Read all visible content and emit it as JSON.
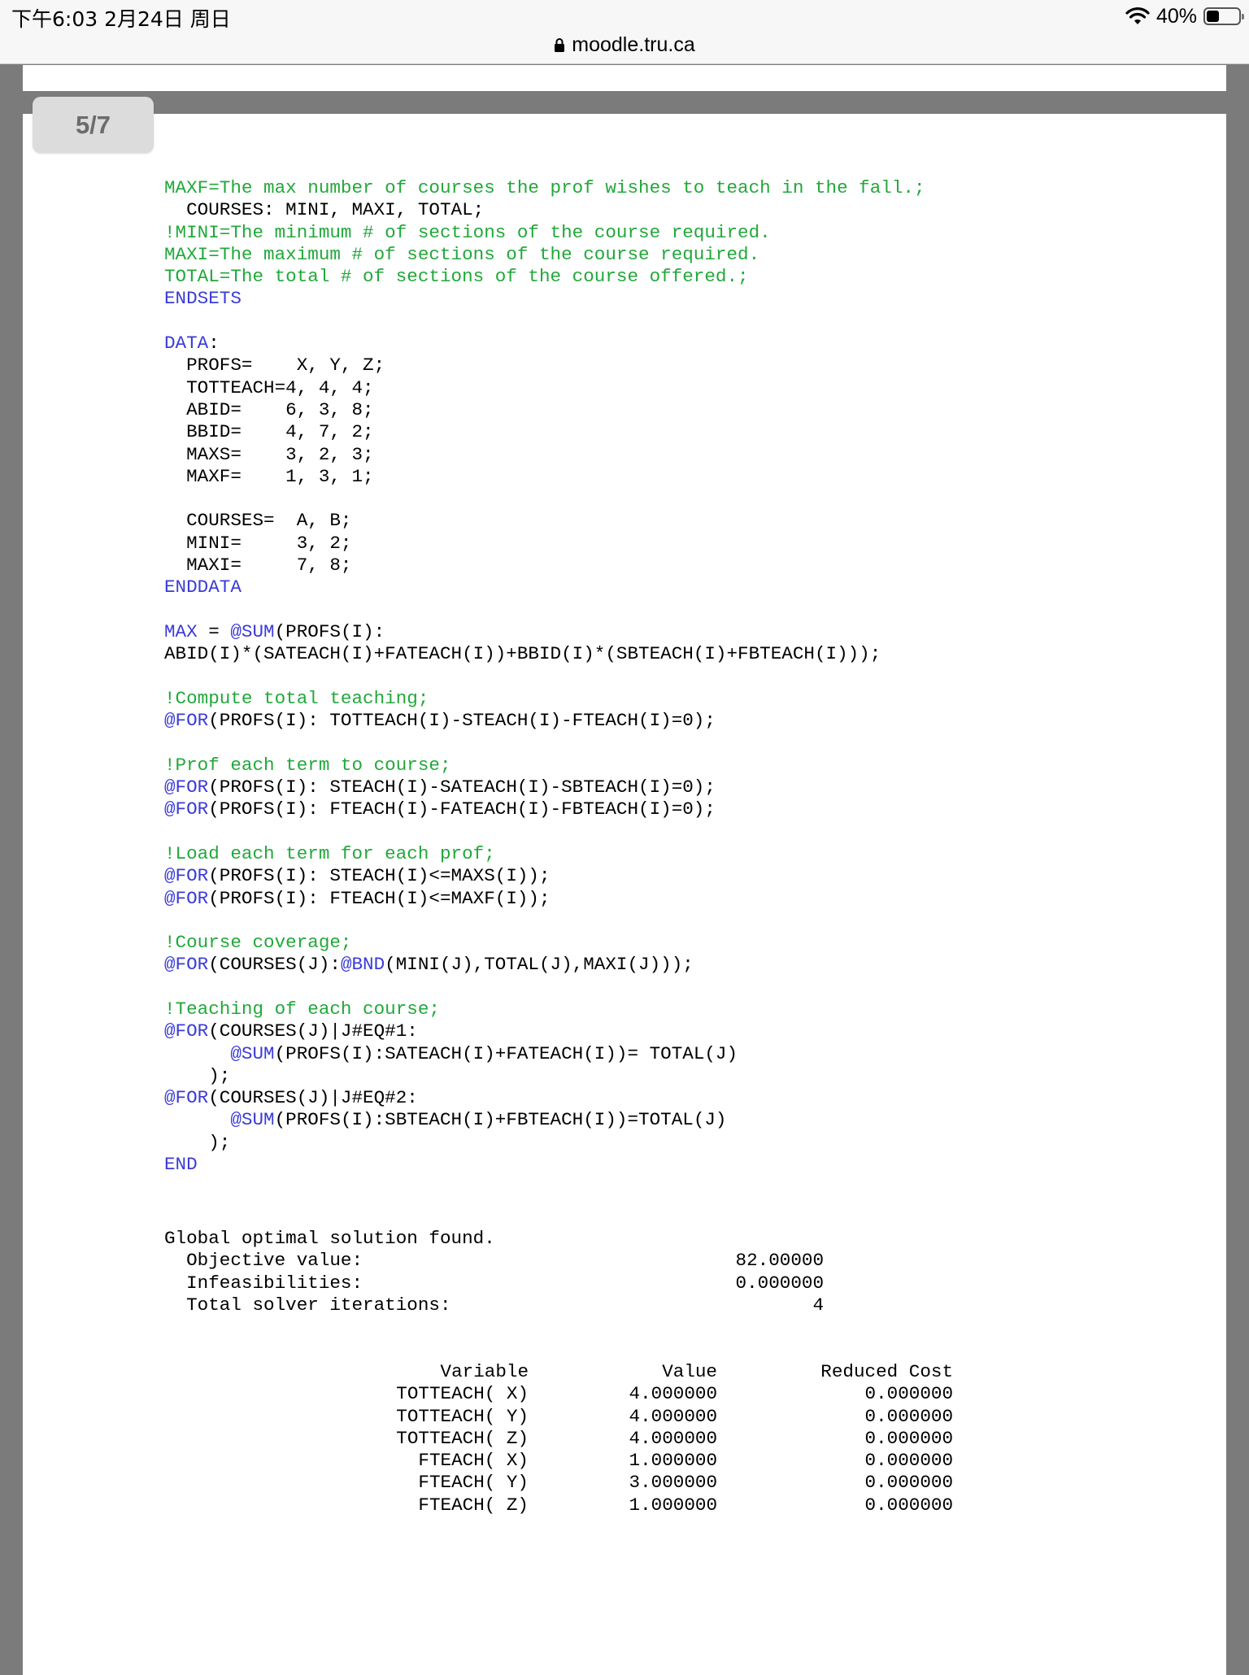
{
  "status": {
    "time_date": "下午6:03   2月24日 周日",
    "battery_percent": "40%",
    "battery_level": 0.4,
    "url": "moodle.tru.ca"
  },
  "viewer": {
    "page_indicator": "5/7"
  },
  "code_lines": [
    [
      [
        "c",
        "MAXF=The max number of courses the prof wishes to teach in the fall.;"
      ]
    ],
    [
      [
        "n",
        "  COURSES: MINI, MAXI, TOTAL;"
      ]
    ],
    [
      [
        "c",
        "!MINI=The minimum # of sections of the course required."
      ]
    ],
    [
      [
        "c",
        "MAXI=The maximum # of sections of the course required."
      ]
    ],
    [
      [
        "c",
        "TOTAL=The total # of sections of the course offered.;"
      ]
    ],
    [
      [
        "k",
        "ENDSETS"
      ]
    ],
    [],
    [
      [
        "k",
        "DATA"
      ],
      [
        "n",
        ":"
      ]
    ],
    [
      [
        "n",
        "  PROFS=    X, Y, Z;"
      ]
    ],
    [
      [
        "n",
        "  TOTTEACH=4, 4, 4;"
      ]
    ],
    [
      [
        "n",
        "  ABID=    6, 3, 8;"
      ]
    ],
    [
      [
        "n",
        "  BBID=    4, 7, 2;"
      ]
    ],
    [
      [
        "n",
        "  MAXS=    3, 2, 3;"
      ]
    ],
    [
      [
        "n",
        "  MAXF=    1, 3, 1;"
      ]
    ],
    [],
    [
      [
        "n",
        "  COURSES=  A, B;"
      ]
    ],
    [
      [
        "n",
        "  MINI=     3, 2;"
      ]
    ],
    [
      [
        "n",
        "  MAXI=     7, 8;"
      ]
    ],
    [
      [
        "k",
        "ENDDATA"
      ]
    ],
    [],
    [
      [
        "k",
        "MAX"
      ],
      [
        "n",
        " = "
      ],
      [
        "k",
        "@SUM"
      ],
      [
        "n",
        "(PROFS(I):"
      ]
    ],
    [
      [
        "n",
        "ABID(I)*(SATEACH(I)+FATEACH(I))+BBID(I)*(SBTEACH(I)+FBTEACH(I)));"
      ]
    ],
    [],
    [
      [
        "c",
        "!Compute total teaching;"
      ]
    ],
    [
      [
        "k",
        "@FOR"
      ],
      [
        "n",
        "(PROFS(I): TOTTEACH(I)-STEACH(I)-FTEACH(I)=0);"
      ]
    ],
    [],
    [
      [
        "c",
        "!Prof each term to course;"
      ]
    ],
    [
      [
        "k",
        "@FOR"
      ],
      [
        "n",
        "(PROFS(I): STEACH(I)-SATEACH(I)-SBTEACH(I)=0);"
      ]
    ],
    [
      [
        "k",
        "@FOR"
      ],
      [
        "n",
        "(PROFS(I): FTEACH(I)-FATEACH(I)-FBTEACH(I)=0);"
      ]
    ],
    [],
    [
      [
        "c",
        "!Load each term for each prof;"
      ]
    ],
    [
      [
        "k",
        "@FOR"
      ],
      [
        "n",
        "(PROFS(I): STEACH(I)<=MAXS(I));"
      ]
    ],
    [
      [
        "k",
        "@FOR"
      ],
      [
        "n",
        "(PROFS(I): FTEACH(I)<=MAXF(I));"
      ]
    ],
    [],
    [
      [
        "c",
        "!Course coverage;"
      ]
    ],
    [
      [
        "k",
        "@FOR"
      ],
      [
        "n",
        "(COURSES(J):"
      ],
      [
        "k",
        "@BND"
      ],
      [
        "n",
        "(MINI(J),TOTAL(J),MAXI(J)));"
      ]
    ],
    [],
    [
      [
        "c",
        "!Teaching of each course;"
      ]
    ],
    [
      [
        "k",
        "@FOR"
      ],
      [
        "n",
        "(COURSES(J)|J#EQ#1:"
      ]
    ],
    [
      [
        "n",
        "      "
      ],
      [
        "k",
        "@SUM"
      ],
      [
        "n",
        "(PROFS(I):SATEACH(I)+FATEACH(I))= TOTAL(J)"
      ]
    ],
    [
      [
        "n",
        "    );"
      ]
    ],
    [
      [
        "k",
        "@FOR"
      ],
      [
        "n",
        "(COURSES(J)|J#EQ#2:"
      ]
    ],
    [
      [
        "n",
        "      "
      ],
      [
        "k",
        "@SUM"
      ],
      [
        "n",
        "(PROFS(I):SBTEACH(I)+FBTEACH(I))=TOTAL(J)"
      ]
    ],
    [
      [
        "n",
        "    );"
      ]
    ],
    [
      [
        "k",
        "END"
      ]
    ]
  ],
  "solution": {
    "heading": "Global optimal solution found.",
    "rows": [
      {
        "label": "  Objective value:",
        "value": "82.00000"
      },
      {
        "label": "  Infeasibilities:",
        "value": "0.000000"
      },
      {
        "label": "  Total solver iterations:",
        "value": "4"
      }
    ]
  },
  "results": {
    "headers": [
      "Variable",
      "Value",
      "Reduced Cost"
    ],
    "rows": [
      [
        "TOTTEACH( X)",
        "4.000000",
        "0.000000"
      ],
      [
        "TOTTEACH( Y)",
        "4.000000",
        "0.000000"
      ],
      [
        "TOTTEACH( Z)",
        "4.000000",
        "0.000000"
      ],
      [
        "FTEACH( X)",
        "1.000000",
        "0.000000"
      ],
      [
        "FTEACH( Y)",
        "3.000000",
        "0.000000"
      ],
      [
        "FTEACH( Z)",
        "1.000000",
        "0.000000"
      ]
    ]
  },
  "colors": {
    "keyword": "#3b3bd8",
    "comment": "#21a83a",
    "viewer_background": "#7b7b7b"
  },
  "icons": [
    "wifi-icon",
    "battery-icon",
    "lock-icon"
  ]
}
